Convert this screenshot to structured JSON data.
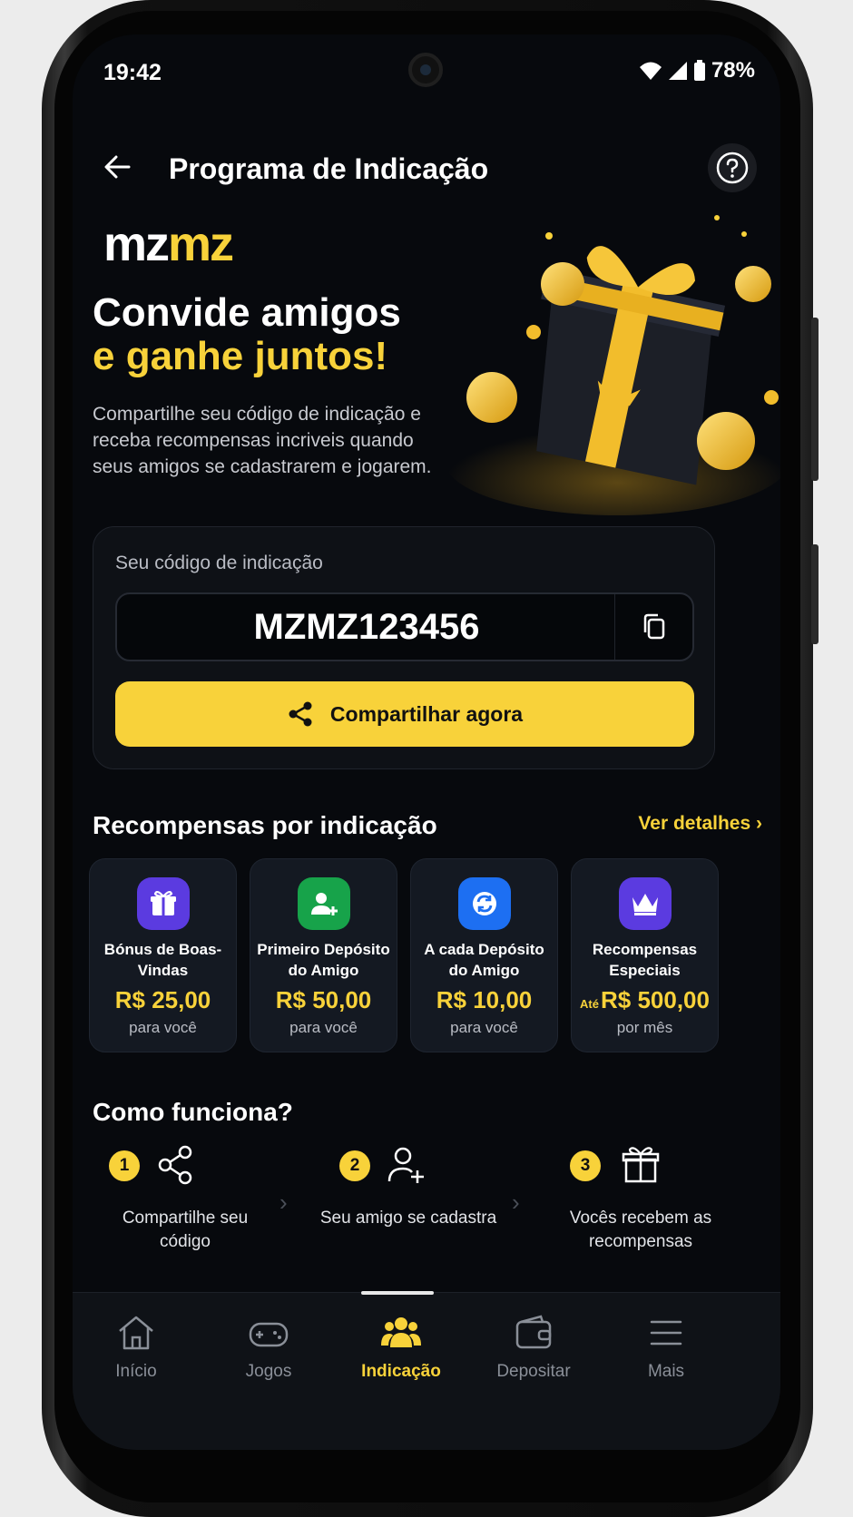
{
  "status": {
    "time": "19:42",
    "battery": "78%"
  },
  "header": {
    "title": "Programa de Indicação"
  },
  "brand": {
    "logo_part1": "mz",
    "logo_part2": "mz"
  },
  "hero": {
    "line1": "Convide amigos",
    "line2": "e ganhe juntos!",
    "description": "Compartilhe seu código de indicação e receba recompensas incriveis quando seus amigos se cadastrarem e jogarem."
  },
  "code_card": {
    "label": "Seu código de indicação",
    "code": "MZMZ123456",
    "share_label": "Compartilhar agora"
  },
  "rewards": {
    "title": "Recompensas por indicação",
    "details_link": "Ver detalhes",
    "items": [
      {
        "name": "Bónus de Boas-Vindas",
        "prefix": "",
        "value": "R$ 25,00",
        "sub": "para você",
        "icon": "gift-icon",
        "color": "#5b3be0"
      },
      {
        "name": "Primeiro Depósito do Amigo",
        "prefix": "",
        "value": "R$ 50,00",
        "sub": "para você",
        "icon": "user-plus-icon",
        "color": "#17a34a"
      },
      {
        "name": "A cada Depósito do Amigo",
        "prefix": "",
        "value": "R$ 10,00",
        "sub": "para você",
        "icon": "refresh-icon",
        "color": "#1d6ff2"
      },
      {
        "name": "Recompensas Especiais",
        "prefix": "Até",
        "value": "R$ 500,00",
        "sub": "por mês",
        "icon": "crown-icon",
        "color": "#5b3be0"
      }
    ]
  },
  "how": {
    "title": "Como funciona?",
    "steps": [
      {
        "num": "1",
        "label": "Compartilhe seu código",
        "icon": "share-icon"
      },
      {
        "num": "2",
        "label": "Seu amigo se cadastra",
        "icon": "user-plus-icon"
      },
      {
        "num": "3",
        "label": "Vocês recebem as recompensas",
        "icon": "gift-icon"
      }
    ]
  },
  "nav": {
    "items": [
      {
        "label": "Início",
        "icon": "home-icon"
      },
      {
        "label": "Jogos",
        "icon": "gamepad-icon"
      },
      {
        "label": "Indicação",
        "icon": "users-icon",
        "active": true
      },
      {
        "label": "Depositar",
        "icon": "wallet-icon"
      },
      {
        "label": "Mais",
        "icon": "menu-icon"
      }
    ]
  },
  "colors": {
    "accent": "#f8d23a",
    "background": "#07090d"
  }
}
